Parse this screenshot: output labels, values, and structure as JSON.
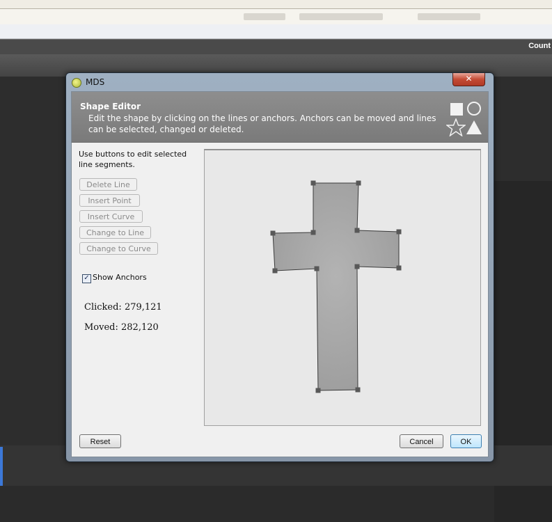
{
  "background": {
    "top_right_label": "Count"
  },
  "dialog": {
    "title": "MDS",
    "close_symbol": "✕",
    "header": {
      "title": "Shape Editor",
      "description": "Edit the shape by clicking on the lines or anchors. Anchors can be moved and lines can be selected, changed or deleted.",
      "shape_icons": [
        "square-icon",
        "circle-icon",
        "star-icon",
        "triangle-icon"
      ]
    },
    "left_panel": {
      "hint": "Use buttons to edit selected line segments.",
      "buttons": {
        "delete_line": "Delete Line",
        "insert_point": "Insert Point",
        "insert_curve": "Insert Curve",
        "change_to_line": "Change to Line",
        "change_to_curve": "Change to Curve"
      },
      "show_anchors_label": "Show Anchors",
      "show_anchors_checked": true,
      "check_mark": "✓",
      "clicked_text": "Clicked: 279,121",
      "moved_text": "Moved: 282,120"
    },
    "footer": {
      "reset_label": "Reset",
      "cancel_label": "Cancel",
      "ok_label": "OK"
    },
    "colors": {
      "shape_fill": "#a6a6a6",
      "anchor": "#5a5a5a",
      "header_band": "#838383"
    }
  }
}
